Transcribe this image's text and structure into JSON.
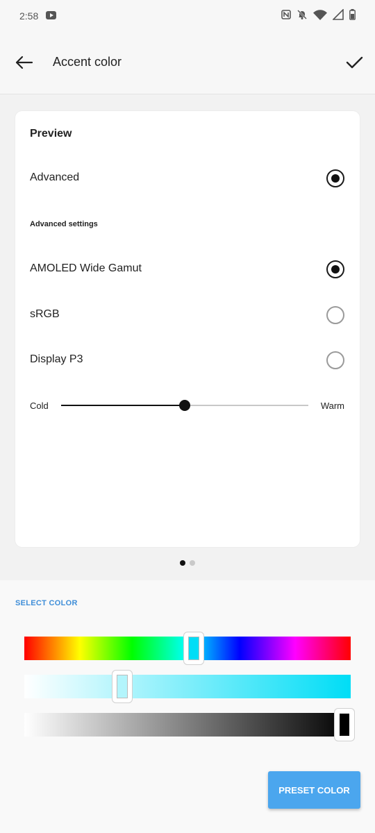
{
  "status_bar": {
    "time": "2:58",
    "icons": [
      "youtube-icon",
      "nfc-icon",
      "bell-off-icon",
      "wifi-icon",
      "signal-icon",
      "battery-icon"
    ]
  },
  "app_bar": {
    "title": "Accent color"
  },
  "card": {
    "preview_title": "Preview",
    "advanced_label": "Advanced",
    "advanced_selected": true,
    "advanced_settings_label": "Advanced settings",
    "options": [
      {
        "label": "AMOLED Wide Gamut",
        "selected": true
      },
      {
        "label": "sRGB",
        "selected": false
      },
      {
        "label": "Display P3",
        "selected": false
      }
    ],
    "temperature": {
      "cold_label": "Cold",
      "warm_label": "Warm",
      "value": 0.5
    }
  },
  "pager": {
    "count": 2,
    "active": 0
  },
  "color_picker": {
    "section_label": "SELECT COLOR",
    "hue_value": 0.52,
    "saturation_value": 0.3,
    "brightness_value": 0.98,
    "selected_color": "#00ddf6",
    "preset_button_label": "PRESET COLOR"
  },
  "colors": {
    "accent": "#4ba6ee",
    "section_label": "#3f8ed8"
  }
}
